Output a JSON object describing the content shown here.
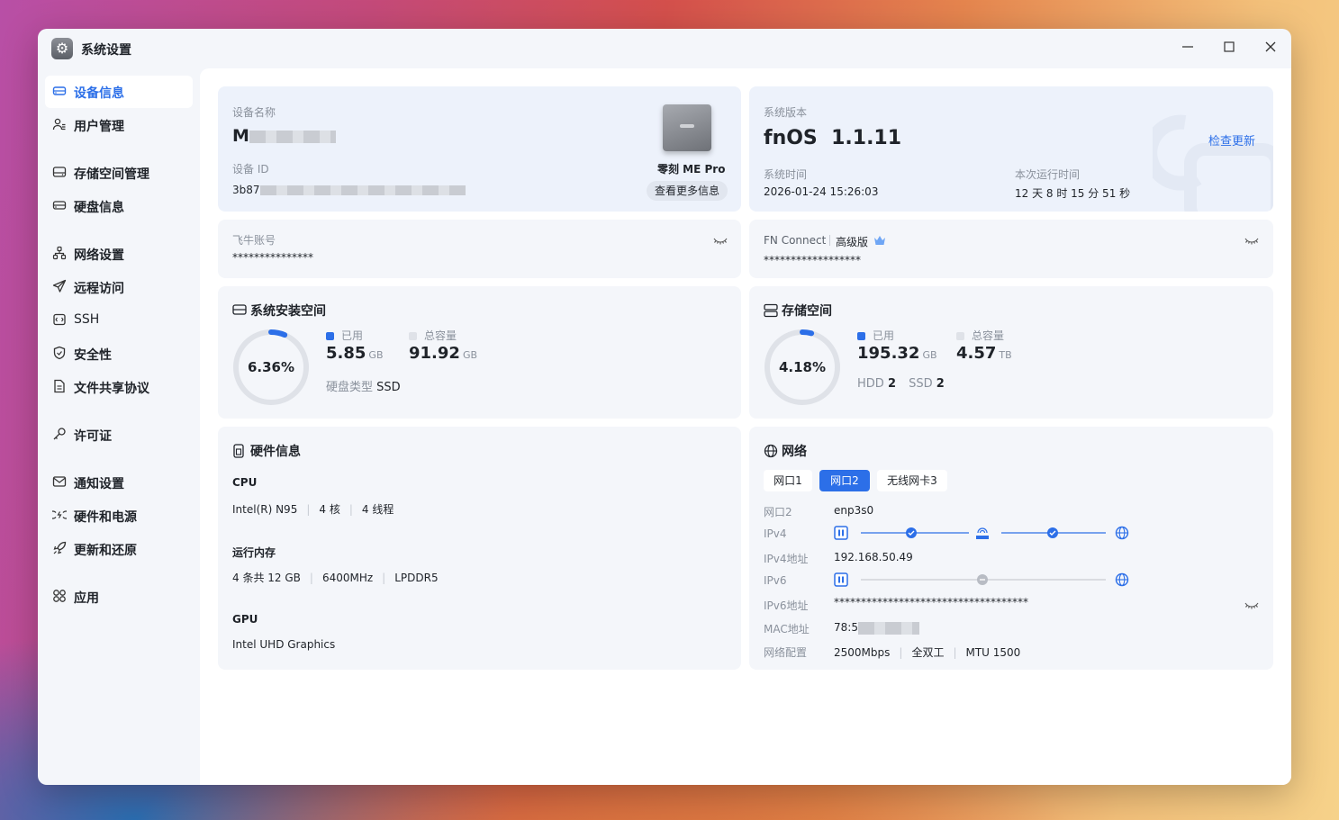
{
  "window": {
    "title": "系统设置",
    "app_icon": "gear-icon",
    "controls": [
      "minimize-icon",
      "maximize-icon",
      "close-icon"
    ]
  },
  "sidebar": {
    "items": [
      {
        "label": "设备信息",
        "icon": "device-icon",
        "active": true
      },
      {
        "label": "用户管理",
        "icon": "users-icon"
      },
      {
        "label": "存储空间管理",
        "icon": "storage-icon"
      },
      {
        "label": "硬盘信息",
        "icon": "disk-icon"
      },
      {
        "label": "网络设置",
        "icon": "network-icon"
      },
      {
        "label": "远程访问",
        "icon": "send-icon"
      },
      {
        "label": "SSH",
        "icon": "terminal-icon"
      },
      {
        "label": "安全性",
        "icon": "shield-icon"
      },
      {
        "label": "文件共享协议",
        "icon": "file-icon"
      },
      {
        "label": "许可证",
        "icon": "key-icon"
      },
      {
        "label": "通知设置",
        "icon": "mail-icon"
      },
      {
        "label": "硬件和电源",
        "icon": "power-icon"
      },
      {
        "label": "更新和还原",
        "icon": "rocket-icon"
      },
      {
        "label": "应用",
        "icon": "apps-icon"
      }
    ]
  },
  "device": {
    "name_label": "设备名称",
    "name_value": "M",
    "id_label": "设备 ID",
    "id_value": "3b87",
    "model": "零刻 ME Pro",
    "more_button": "查看更多信息"
  },
  "system": {
    "version_label": "系统版本",
    "version_value": "fnOS  1.1.11",
    "check_update": "检查更新",
    "time_label": "系统时间",
    "time_value": "2026-01-24 15:26:03",
    "uptime_label": "本次运行时间",
    "uptime_value": "12 天 8 时 15 分 51 秒"
  },
  "account": {
    "label": "飞牛账号",
    "value": "***************"
  },
  "fn_connect": {
    "label": "FN Connect",
    "tier": "高级版",
    "value": "******************"
  },
  "sys_space": {
    "title": "系统安装空间",
    "percent": "6.36%",
    "percent_value": 6.36,
    "used_label": "已用",
    "used_value": "5.85",
    "used_unit": "GB",
    "total_label": "总容量",
    "total_value": "91.92",
    "total_unit": "GB",
    "disk_type_label": "硬盘类型",
    "disk_type_value": "SSD",
    "accent": "#2c6fe8"
  },
  "storage": {
    "title": "存储空间",
    "percent": "4.18%",
    "percent_value": 4.18,
    "used_label": "已用",
    "used_value": "195.32",
    "used_unit": "GB",
    "total_label": "总容量",
    "total_value": "4.57",
    "total_unit": "TB",
    "hdd_label": "HDD",
    "hdd_value": "2",
    "ssd_label": "SSD",
    "ssd_value": "2"
  },
  "hardware": {
    "title": "硬件信息",
    "cpu_label": "CPU",
    "cpu_model": "Intel(R) N95",
    "cpu_cores": "4 核",
    "cpu_threads": "4 线程",
    "mem_label": "运行内存",
    "mem_size": "4 条共 12 GB",
    "mem_speed": "6400MHz",
    "mem_type": "LPDDR5",
    "gpu_label": "GPU",
    "gpu_model": "Intel UHD Graphics"
  },
  "network": {
    "title": "网络",
    "tabs": [
      {
        "label": "网口1",
        "active": false
      },
      {
        "label": "网口2",
        "active": true
      },
      {
        "label": "无线网卡3",
        "active": false
      }
    ],
    "port_label": "网口2",
    "port_value": "enp3s0",
    "ipv4_label": "IPv4",
    "ipv4_addr_label": "IPv4地址",
    "ipv4_addr_value": "192.168.50.49",
    "ipv6_label": "IPv6",
    "ipv6_addr_label": "IPv6地址",
    "ipv6_addr_value": "************************************",
    "mac_label": "MAC地址",
    "mac_value": "78:5",
    "config_label": "网络配置",
    "speed": "2500Mbps",
    "duplex": "全双工",
    "mtu": "MTU 1500"
  }
}
